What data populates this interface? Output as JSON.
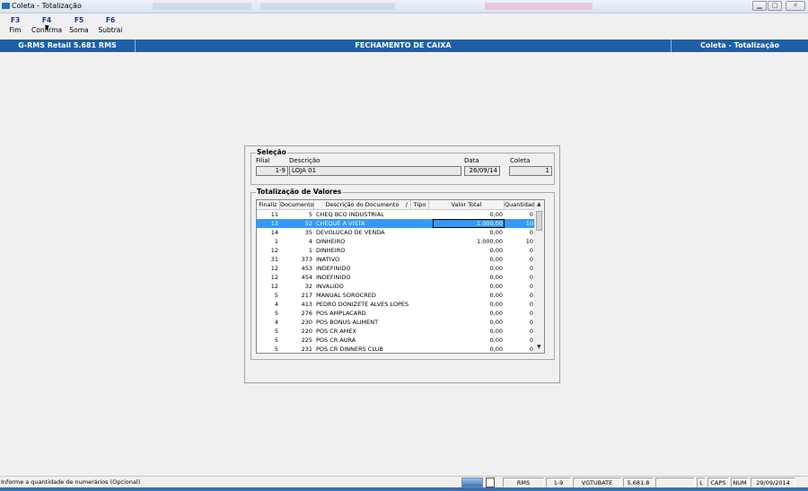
{
  "window": {
    "title": "Coleta - Totalização"
  },
  "toolbar": [
    {
      "key": "F3",
      "label": "Fim"
    },
    {
      "key": "F4",
      "label": "Confirma"
    },
    {
      "key": "F5",
      "label": "Soma"
    },
    {
      "key": "F6",
      "label": "Subtrai"
    }
  ],
  "header": {
    "product": "G-RMS Retail 5.681 RMS",
    "screen": "FECHAMENTO DE CAIXA",
    "module": "Coleta - Totalização"
  },
  "selecao": {
    "title": "Seleção",
    "filial_label": "Filial",
    "descricao_label": "Descrição",
    "data_label": "Data",
    "coleta_label": "Coleta",
    "filial": "1-9",
    "descricao": "LOJA 01",
    "data": "26/09/14",
    "coleta": "1"
  },
  "totalizacao": {
    "title": "Totalização de Valores",
    "columns": [
      "Finaliz",
      "Documento",
      "Descrição do Documento",
      "/",
      "Tipo",
      "Valor Total",
      "Quantidade"
    ],
    "rows": [
      {
        "finaliz": "11",
        "documento": "5",
        "descricao": "CHEQ BCO INDUSTRIAL",
        "tipo": "",
        "valor": "0,00",
        "quantidade": "0"
      },
      {
        "finaliz": "13",
        "documento": "52",
        "descricao": "CHEQUE A VISTA",
        "tipo": "",
        "valor": "1.000,00",
        "quantidade": "10",
        "selected": true
      },
      {
        "finaliz": "14",
        "documento": "35",
        "descricao": "DEVOLUCAO DE VENDA",
        "tipo": "",
        "valor": "0,00",
        "quantidade": "0"
      },
      {
        "finaliz": "1",
        "documento": "4",
        "descricao": "DINHEIRO",
        "tipo": "",
        "valor": "1.000,00",
        "quantidade": "10"
      },
      {
        "finaliz": "12",
        "documento": "1",
        "descricao": "DINHEIRO",
        "tipo": "",
        "valor": "0,00",
        "quantidade": "0"
      },
      {
        "finaliz": "31",
        "documento": "373",
        "descricao": "INATIVO",
        "tipo": "",
        "valor": "0,00",
        "quantidade": "0"
      },
      {
        "finaliz": "12",
        "documento": "453",
        "descricao": "INDEFINIDO",
        "tipo": "",
        "valor": "0,00",
        "quantidade": "0"
      },
      {
        "finaliz": "12",
        "documento": "454",
        "descricao": "INDEFINIDO",
        "tipo": "",
        "valor": "0,00",
        "quantidade": "0"
      },
      {
        "finaliz": "12",
        "documento": "32",
        "descricao": "INVALIDO",
        "tipo": "",
        "valor": "0,00",
        "quantidade": "0"
      },
      {
        "finaliz": "5",
        "documento": "217",
        "descricao": "MANUAL SOROCRED",
        "tipo": "",
        "valor": "0,00",
        "quantidade": "0"
      },
      {
        "finaliz": "4",
        "documento": "413",
        "descricao": "PEDRO DONIZETE ALVES LOPES",
        "tipo": "",
        "valor": "0,00",
        "quantidade": "0"
      },
      {
        "finaliz": "5",
        "documento": "276",
        "descricao": "POS AMPLACARD",
        "tipo": "",
        "valor": "0,00",
        "quantidade": "0"
      },
      {
        "finaliz": "4",
        "documento": "230",
        "descricao": "POS BONUS ALIMENT",
        "tipo": "",
        "valor": "0,00",
        "quantidade": "0"
      },
      {
        "finaliz": "5",
        "documento": "220",
        "descricao": "POS CR AMEX",
        "tipo": "",
        "valor": "0,00",
        "quantidade": "0"
      },
      {
        "finaliz": "5",
        "documento": "225",
        "descricao": "POS CR AURA",
        "tipo": "",
        "valor": "0,00",
        "quantidade": "0"
      },
      {
        "finaliz": "5",
        "documento": "231",
        "descricao": "POS CR DINNERS CLUB",
        "tipo": "",
        "valor": "0,00",
        "quantidade": "0"
      }
    ]
  },
  "statusbar": {
    "message": "Informe a quantidade de numerários (Opcional)",
    "panels": [
      "RMS",
      "1-9",
      "VGTUBATE",
      "5.681.8",
      "",
      "L",
      "CAPS",
      "NUM",
      "29/09/2014"
    ]
  }
}
